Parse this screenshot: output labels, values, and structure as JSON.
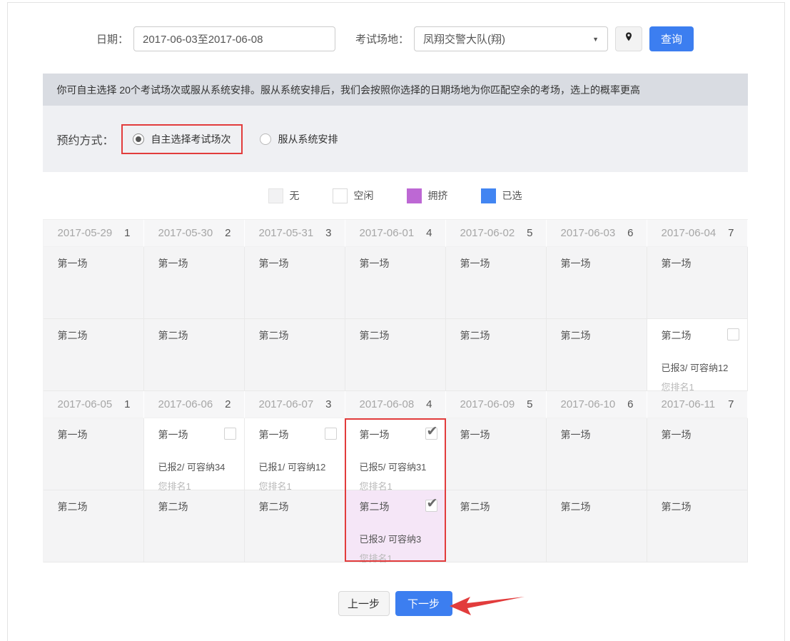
{
  "filter": {
    "date_label": "日期：",
    "date_value": "2017-06-03至2017-06-08",
    "venue_label": "考试场地：",
    "venue_value": "凤翔交警大队(翔)",
    "query_label": "查询"
  },
  "notice": "你可自主选择 20个考试场次或服从系统安排。服从系统安排后，我们会按照你选择的日期场地为你匹配空余的考场，选上的概率更高",
  "booking_method": {
    "label": "预约方式：",
    "options": [
      {
        "label": "自主选择考试场次",
        "selected": true,
        "highlighted": true
      },
      {
        "label": "服从系统安排",
        "selected": false,
        "highlighted": false
      }
    ]
  },
  "legend": [
    {
      "label": "无",
      "color": "#f2f2f3",
      "border": "#e3e3e3"
    },
    {
      "label": "空闲",
      "color": "#ffffff",
      "border": "#d9d9d9"
    },
    {
      "label": "拥挤",
      "color": "#bd68d4",
      "border": "#bd68d4"
    },
    {
      "label": "已选",
      "color": "#4285f2",
      "border": "#4285f2"
    }
  ],
  "calendar": {
    "weeks": [
      {
        "days": [
          {
            "date": "2017-05-29",
            "num": "1",
            "sessions": [
              {
                "label": "第一场",
                "state": "none"
              },
              {
                "label": "第二场",
                "state": "none"
              }
            ]
          },
          {
            "date": "2017-05-30",
            "num": "2",
            "sessions": [
              {
                "label": "第一场",
                "state": "none"
              },
              {
                "label": "第二场",
                "state": "none"
              }
            ]
          },
          {
            "date": "2017-05-31",
            "num": "3",
            "sessions": [
              {
                "label": "第一场",
                "state": "none"
              },
              {
                "label": "第二场",
                "state": "none"
              }
            ]
          },
          {
            "date": "2017-06-01",
            "num": "4",
            "sessions": [
              {
                "label": "第一场",
                "state": "none"
              },
              {
                "label": "第二场",
                "state": "none"
              }
            ]
          },
          {
            "date": "2017-06-02",
            "num": "5",
            "sessions": [
              {
                "label": "第一场",
                "state": "none"
              },
              {
                "label": "第二场",
                "state": "none"
              }
            ]
          },
          {
            "date": "2017-06-03",
            "num": "6",
            "sessions": [
              {
                "label": "第一场",
                "state": "none"
              },
              {
                "label": "第二场",
                "state": "none"
              }
            ]
          },
          {
            "date": "2017-06-04",
            "num": "7",
            "sessions": [
              {
                "label": "第一场",
                "state": "none"
              },
              {
                "label": "第二场",
                "state": "free",
                "checkbox": true,
                "checked": false,
                "stats": "已报3/ 可容纳12",
                "rank": "您排名1"
              }
            ]
          }
        ]
      },
      {
        "days": [
          {
            "date": "2017-06-05",
            "num": "1",
            "sessions": [
              {
                "label": "第一场",
                "state": "none"
              },
              {
                "label": "第二场",
                "state": "none"
              }
            ]
          },
          {
            "date": "2017-06-06",
            "num": "2",
            "sessions": [
              {
                "label": "第一场",
                "state": "free",
                "checkbox": true,
                "checked": false,
                "stats": "已报2/ 可容纳34",
                "rank": "您排名1"
              },
              {
                "label": "第二场",
                "state": "none"
              }
            ]
          },
          {
            "date": "2017-06-07",
            "num": "3",
            "sessions": [
              {
                "label": "第一场",
                "state": "free",
                "checkbox": true,
                "checked": false,
                "stats": "已报1/ 可容纳12",
                "rank": "您排名1"
              },
              {
                "label": "第二场",
                "state": "none"
              }
            ]
          },
          {
            "date": "2017-06-08",
            "num": "4",
            "highlighted": true,
            "sessions": [
              {
                "label": "第一场",
                "state": "free",
                "checkbox": true,
                "checked": true,
                "stats": "已报5/ 可容纳31",
                "rank": "您排名1"
              },
              {
                "label": "第二场",
                "state": "crowded",
                "checkbox": true,
                "checked": true,
                "stats": "已报3/ 可容纳3",
                "rank": "您排名1"
              }
            ]
          },
          {
            "date": "2017-06-09",
            "num": "5",
            "sessions": [
              {
                "label": "第一场",
                "state": "none"
              },
              {
                "label": "第二场",
                "state": "none"
              }
            ]
          },
          {
            "date": "2017-06-10",
            "num": "6",
            "sessions": [
              {
                "label": "第一场",
                "state": "none"
              },
              {
                "label": "第二场",
                "state": "none"
              }
            ]
          },
          {
            "date": "2017-06-11",
            "num": "7",
            "sessions": [
              {
                "label": "第一场",
                "state": "none"
              },
              {
                "label": "第二场",
                "state": "none"
              }
            ]
          }
        ]
      }
    ]
  },
  "footer": {
    "prev_label": "上一步",
    "next_label": "下一步"
  },
  "colors": {
    "accent_blue": "#3c7ef0",
    "crowded_purple": "#bd68d4",
    "selected_blue": "#4285f2",
    "crowded_cell_pink": "#f5e6f7",
    "annotation_red": "#e23c3c",
    "banner_bg": "#d9dce2"
  }
}
